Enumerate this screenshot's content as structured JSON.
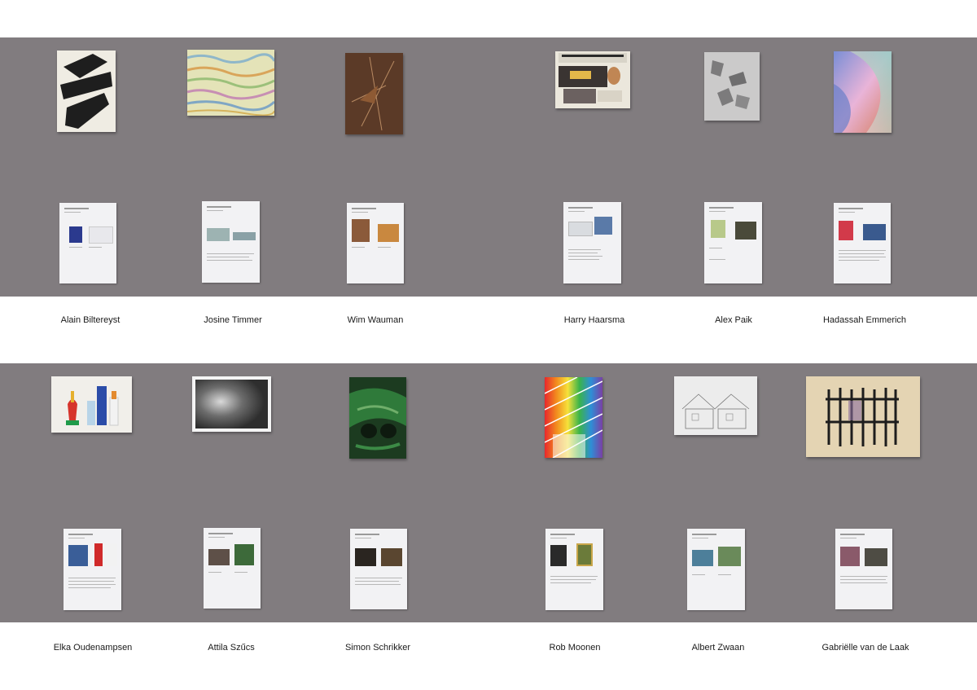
{
  "row1": {
    "artists": [
      {
        "name": "Alain Biltereyst"
      },
      {
        "name": "Josine Timmer"
      },
      {
        "name": "Wim Wauman"
      },
      {
        "name": "Harry Haarsma"
      },
      {
        "name": "Alex Paik"
      },
      {
        "name": "Hadassah Emmerich"
      }
    ]
  },
  "row2": {
    "artists": [
      {
        "name": "Elka Oudenampsen"
      },
      {
        "name": "Attila Szűcs"
      },
      {
        "name": "Simon Schrikker"
      },
      {
        "name": "Rob Moonen"
      },
      {
        "name": "Albert Zwaan"
      },
      {
        "name": "Gabriëlle van de Laak"
      }
    ]
  },
  "colors": {
    "wall": "#817c7f",
    "background": "#ffffff",
    "sheet": "#f2f2f4"
  }
}
